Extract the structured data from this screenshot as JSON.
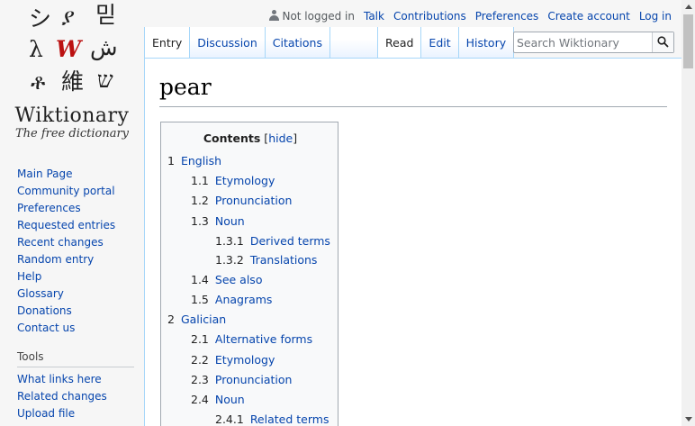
{
  "logo": {
    "glyphs": [
      "シ",
      "ያ",
      "믿",
      "λ",
      "W",
      "ش",
      "ቶ",
      "維",
      "ש"
    ],
    "wordmark": "Wiktionary",
    "tagline": "The free dictionary"
  },
  "sidebar": {
    "nav": [
      "Main Page",
      "Community portal",
      "Preferences",
      "Requested entries",
      "Recent changes",
      "Random entry",
      "Help",
      "Glossary",
      "Donations",
      "Contact us"
    ],
    "tools_heading": "Tools",
    "tools": [
      "What links here",
      "Related changes",
      "Upload file"
    ]
  },
  "personal": {
    "not_logged_in": "Not logged in",
    "links": [
      "Talk",
      "Contributions",
      "Preferences",
      "Create account",
      "Log in"
    ]
  },
  "tabs": {
    "namespaces": [
      "Entry",
      "Discussion",
      "Citations"
    ],
    "views": [
      "Read",
      "Edit",
      "History"
    ]
  },
  "search": {
    "placeholder": "Search Wiktionary"
  },
  "page": {
    "title": "pear"
  },
  "toc": {
    "title": "Contents",
    "toggle_open": "[",
    "toggle": "hide",
    "toggle_close": "]",
    "items": [
      {
        "num": "1",
        "text": "English",
        "level": 1
      },
      {
        "num": "1.1",
        "text": "Etymology",
        "level": 2
      },
      {
        "num": "1.2",
        "text": "Pronunciation",
        "level": 2
      },
      {
        "num": "1.3",
        "text": "Noun",
        "level": 2
      },
      {
        "num": "1.3.1",
        "text": "Derived terms",
        "level": 3
      },
      {
        "num": "1.3.2",
        "text": "Translations",
        "level": 3
      },
      {
        "num": "1.4",
        "text": "See also",
        "level": 2
      },
      {
        "num": "1.5",
        "text": "Anagrams",
        "level": 2
      },
      {
        "num": "2",
        "text": "Galician",
        "level": 1
      },
      {
        "num": "2.1",
        "text": "Alternative forms",
        "level": 2
      },
      {
        "num": "2.2",
        "text": "Etymology",
        "level": 2
      },
      {
        "num": "2.3",
        "text": "Pronunciation",
        "level": 2
      },
      {
        "num": "2.4",
        "text": "Noun",
        "level": 2
      },
      {
        "num": "2.4.1",
        "text": "Related terms",
        "level": 3
      }
    ]
  },
  "colors": {
    "link": "#0645ad",
    "tab_border": "#a7d7f9",
    "logo_red": "#b11"
  }
}
